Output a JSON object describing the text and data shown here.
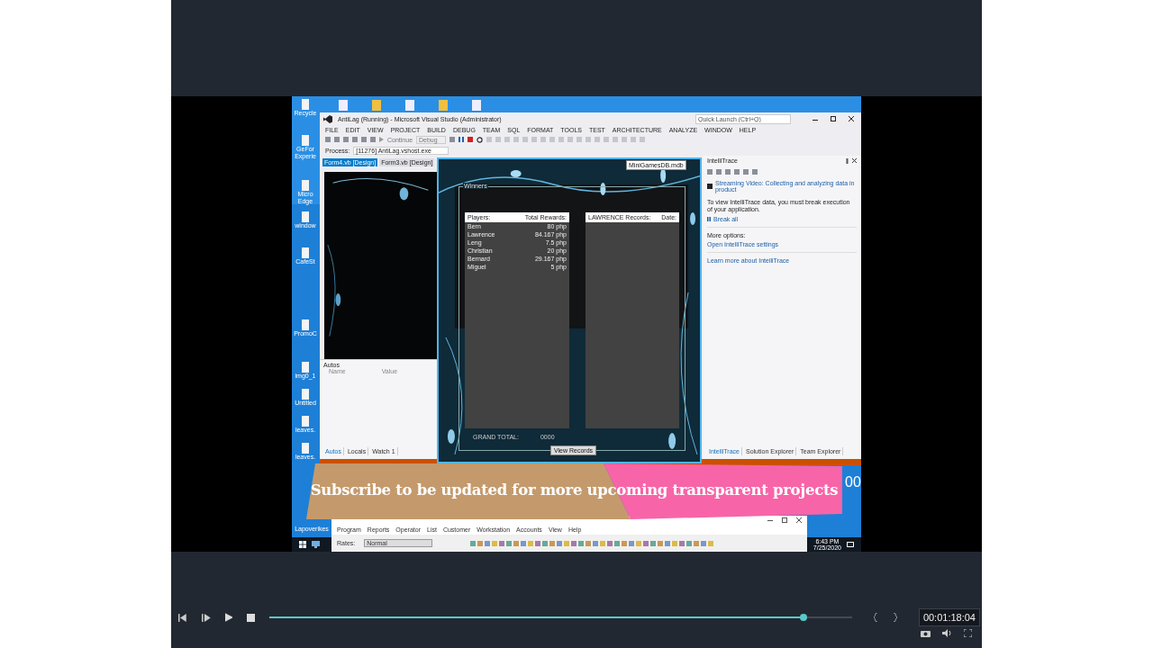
{
  "desktop_icons": [
    {
      "label": "Recycle"
    },
    {
      "label": "GeFor Experie"
    },
    {
      "label": "Micro Edge"
    },
    {
      "label": "window"
    },
    {
      "label": "CafeSt"
    },
    {
      "label": "PromoC"
    },
    {
      "label": "img0_1"
    },
    {
      "label": "Untitled"
    },
    {
      "label": "leaves."
    },
    {
      "label": "leaves."
    },
    {
      "label": "Lapoverikes"
    }
  ],
  "vs": {
    "title": "AntiLag (Running) - Microsoft Visual Studio (Administrator)",
    "quick_launch": {
      "placeholder": "Quick Launch (Ctrl+Q)"
    },
    "menu": [
      "FILE",
      "EDIT",
      "VIEW",
      "PROJECT",
      "BUILD",
      "DEBUG",
      "TEAM",
      "SQL",
      "FORMAT",
      "TOOLS",
      "TEST",
      "ARCHITECTURE",
      "ANALYZE",
      "WINDOW",
      "HELP"
    ],
    "toolbar": {
      "continue": "Continue",
      "config": "Debug"
    },
    "process": {
      "label": "Process:",
      "value": "[11276] AntiLag.vshost.exe"
    },
    "tabs": [
      {
        "label": "Form4.vb [Design]",
        "selected": true
      },
      {
        "label": "Form3.vb [Design]",
        "selected": false
      }
    ],
    "autos": {
      "title": "Autos",
      "columns": [
        "Name",
        "Value"
      ],
      "tabs": [
        {
          "label": "Autos",
          "selected": true
        },
        {
          "label": "Locals",
          "selected": false
        },
        {
          "label": "Watch 1",
          "selected": false
        }
      ]
    },
    "intellitrace": {
      "title": "IntelliTrace",
      "source": "Streaming Video: Collecting and analyzing data in product",
      "message": "To view IntelliTrace data, you must break execution of your application.",
      "break_all": "Break all",
      "more_options": "More options:",
      "settings_link": "Open IntelliTrace settings",
      "learn_link": "Learn more about IntelliTrace",
      "tabs": [
        {
          "label": "IntelliTrace",
          "selected": true
        },
        {
          "label": "Solution Explorer",
          "selected": false
        },
        {
          "label": "Team Explorer",
          "selected": false
        }
      ]
    }
  },
  "form": {
    "tooltip": "MiniGamesDB.mdb",
    "group": "Winners",
    "winners": {
      "columns": [
        "Players:",
        "Total Rewards:"
      ],
      "rows": [
        {
          "player": "Bern",
          "reward": "80 php"
        },
        {
          "player": "Lawrence",
          "reward": "84.167 php"
        },
        {
          "player": "Leng",
          "reward": "7.5 php"
        },
        {
          "player": "Christian",
          "reward": "20 php"
        },
        {
          "player": "Bernard",
          "reward": "29.167 php"
        },
        {
          "player": "Miguel",
          "reward": "5 php"
        }
      ]
    },
    "records": {
      "columns": [
        "LAWRENCE Records:",
        "Date:"
      ]
    },
    "grand_total_label": "GRAND TOTAL:",
    "grand_total": "0000",
    "button": "View Records"
  },
  "banner": "Subscribe to be updated for more upcoming transparent projects",
  "edge_digits": "00",
  "pos_window": {
    "menu": [
      "Program",
      "Reports",
      "Operator",
      "List",
      "Customer",
      "Workstation",
      "Accounts",
      "View",
      "Help"
    ],
    "rates_label": "Rates:",
    "rates_value": "Normal"
  },
  "taskbar": {
    "time": "6:43 PM",
    "date": "7/25/2020"
  },
  "player": {
    "level": 0.916,
    "timecode": "00:01:18:04"
  }
}
